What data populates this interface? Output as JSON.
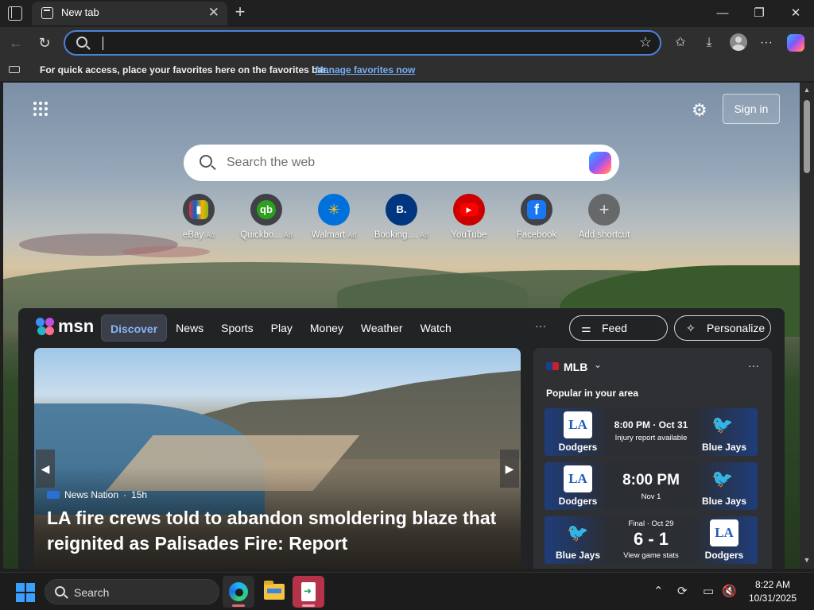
{
  "browser": {
    "tab_title": "New tab",
    "address_value": "",
    "favorites_bar": {
      "message": "For quick access, place your favorites here on the favorites bar.",
      "link": "Manage favorites now"
    }
  },
  "newtab": {
    "signin_label": "Sign in",
    "search_placeholder": "Search the web",
    "shortcuts": [
      {
        "label": "eBay",
        "ad": "Ad",
        "icon": "ebay-icon",
        "color": "#2b2b2b"
      },
      {
        "label": "Quickbo...",
        "ad": "Ad",
        "icon": "quickbooks-icon",
        "color": "#2ca01c"
      },
      {
        "label": "Walmart",
        "ad": "Ad",
        "icon": "walmart-icon",
        "color": "#0071dc"
      },
      {
        "label": "Booking....",
        "ad": "Ad",
        "icon": "booking-icon",
        "color": "#003580"
      },
      {
        "label": "YouTube",
        "ad": "",
        "icon": "youtube-icon",
        "color": "#ff0000"
      },
      {
        "label": "Facebook",
        "ad": "",
        "icon": "facebook-icon",
        "color": "#1877f2"
      },
      {
        "label": "Add shortcut",
        "ad": "",
        "icon": "plus-icon",
        "color": "#555555"
      }
    ]
  },
  "feed": {
    "brand": "msn",
    "tabs": [
      "Discover",
      "News",
      "Sports",
      "Play",
      "Money",
      "Weather",
      "Watch"
    ],
    "more": "···",
    "feed_layout_label": "Feed layout",
    "personalize_label": "Personalize",
    "hero": {
      "source": "News Nation",
      "age": "15h",
      "headline": "LA fire crews told to abandon smoldering blaze that reignited as Palisades Fire: Report"
    },
    "sports": {
      "league": "MLB",
      "more": "···",
      "subtitle": "Popular in your area",
      "games": [
        {
          "left_team": "Dodgers",
          "left_logo": "LA",
          "right_team": "Blue Jays",
          "right_logo": "jays",
          "main": "8:00 PM · Oct 31",
          "sub": "Injury report available"
        },
        {
          "left_team": "Dodgers",
          "left_logo": "LA",
          "right_team": "Blue Jays",
          "right_logo": "jays",
          "main": "8:00 PM",
          "sub": "Nov 1"
        },
        {
          "left_team": "Blue Jays",
          "left_logo": "jays",
          "right_team": "Dodgers",
          "right_logo": "LA",
          "top": "Final · Oct 29",
          "main": "6 - 1",
          "sub": "View game stats"
        }
      ]
    }
  },
  "taskbar": {
    "search_label": "Search",
    "time": "8:22 AM",
    "date": "10/31/2025"
  },
  "colors": {
    "accent": "#4a82d8",
    "link": "#76aff7",
    "discover_active": "#8ab4f8"
  }
}
